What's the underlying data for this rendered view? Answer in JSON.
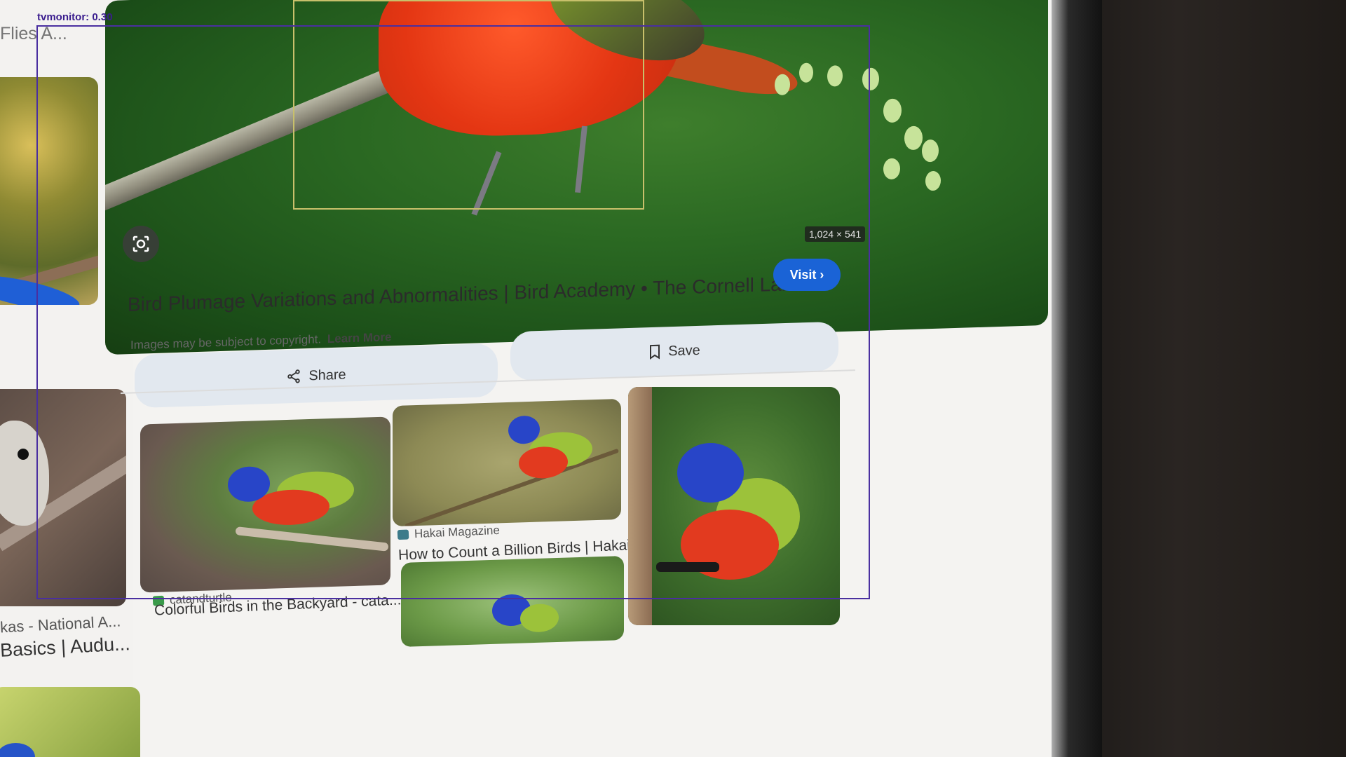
{
  "left_column": {
    "top_title": "Flies A...",
    "source": "kas - National A...",
    "description": "Basics | Audu..."
  },
  "hero": {
    "dimensions": "1,024 × 541",
    "lens_icon": "google-lens-icon"
  },
  "result": {
    "title": "Bird Plumage Variations and Abnormalities | Bird Academy • The Cornell Lab",
    "copyright_text": "Images may be subject to copyright.",
    "learn_more": "Learn More",
    "visit_label": "Visit",
    "share_label": "Share",
    "save_label": "Save"
  },
  "related": [
    {
      "source": "catandturtle",
      "description": "Colorful Birds in the Backyard - cata..."
    },
    {
      "source": "Hakai Magazine",
      "description": "How to Count a Billion Birds | Hakai ..."
    }
  ],
  "detection": {
    "label": "tvmonitor:",
    "score": "0.30"
  },
  "colors": {
    "accent_blue": "#1a63d6",
    "detection_frame": "#4a2fa0",
    "detection_box": "#c8c06b"
  }
}
